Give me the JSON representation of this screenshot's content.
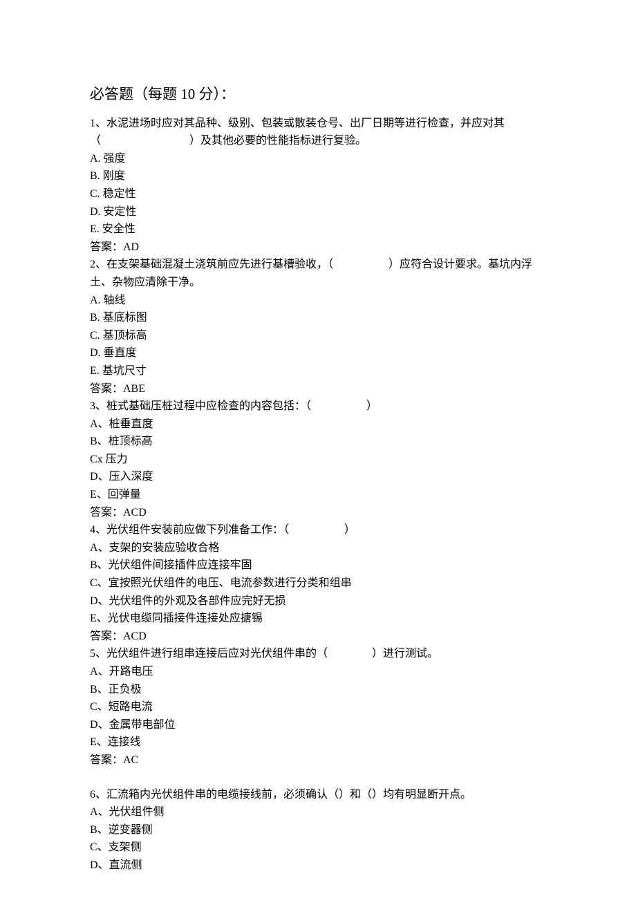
{
  "title": "必答题（每题 10 分）：",
  "questions": [
    {
      "stem": "1、水泥进场时应对其品种、级别、包装或散装仓号、出厂日期等进行检查，并应对其（　　　　　　　　）及其他必要的性能指标进行复验。",
      "options": [
        "A. 强度",
        "B. 刚度",
        "C. 稳定性",
        "D. 安定性",
        "E. 安全性"
      ],
      "answer": "答案：AD"
    },
    {
      "stem": "2、在支架基础混凝土浇筑前应先进行基槽验收，（　　　　　）应符合设计要求。基坑内浮土、杂物应清除干净。",
      "options": [
        "A. 轴线",
        "B. 基底标图",
        "C. 基顶标高",
        "D. 垂直度",
        "E. 基坑尺寸"
      ],
      "answer": "答案：ABE"
    },
    {
      "stem": "3、桩式基础压桩过程中应检查的内容包括：（　　　　　）",
      "options": [
        "A、桩垂直度",
        "B、桩顶标高",
        "Cx 压力",
        "D、压入深度",
        "E、回弹量"
      ],
      "answer": "答案：ACD"
    },
    {
      "stem": "4、光伏组件安装前应做下列准备工作：（　　　　　）",
      "options": [
        "A、支架的安装应验收合格",
        "B、光伏组件间接插件应连接牢固",
        "C、宜按照光伏组件的电压、电流参数进行分类和组串",
        "D、光伏组件的外观及各部件应完好无损",
        "E、光伏电缆同插接件连接处应搪锡"
      ],
      "answer": "答案：ACD"
    },
    {
      "stem": "5、光伏组件进行组串连接后应对光伏组件串的（　　　　）进行测试。",
      "options": [
        "A、开路电压",
        "B、正负极",
        "C、短路电流",
        "D、金属带电部位",
        "E、连接线"
      ],
      "answer": "答案：AC"
    },
    {
      "stem": "6、汇流箱内光伏组件串的电缆接线前，必须确认（）和（）均有明显断开点。",
      "options": [
        "A、光伏组件侧",
        "B、逆变器侧",
        "C、支架侧",
        "D、直流侧"
      ],
      "answer": ""
    }
  ]
}
